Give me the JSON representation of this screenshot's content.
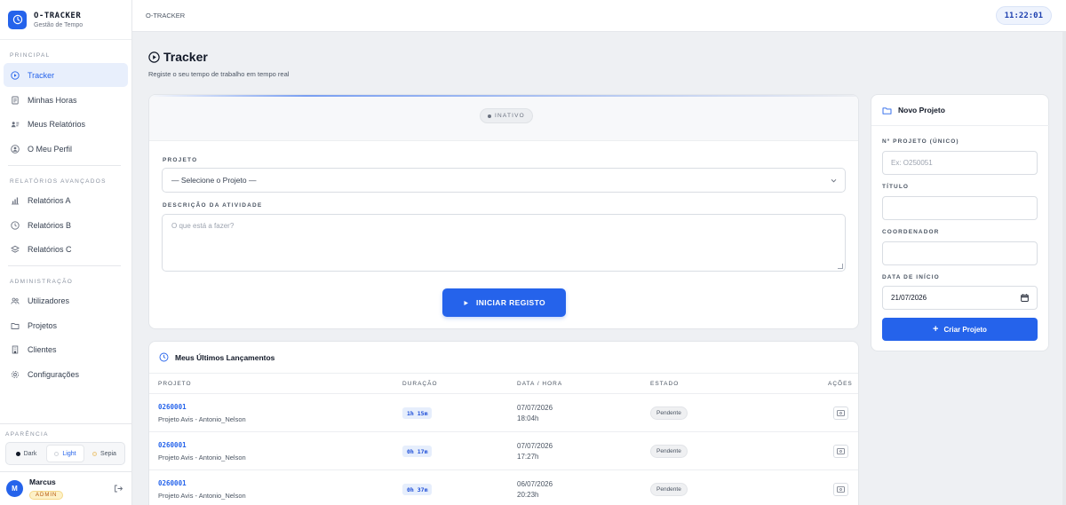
{
  "app": {
    "title": "O-TRACKER",
    "subtitle": "Gestão de Tempo",
    "breadcrumb": "O-TRACKER",
    "clock": "11:22:01"
  },
  "sidebar": {
    "sections": {
      "principal": "PRINCIPAL",
      "avancados": "RELATÓRIOS AVANÇADOS",
      "admin": "ADMINISTRAÇÃO",
      "aparencia": "APARÊNCIA"
    },
    "items": [
      {
        "label": "Tracker",
        "icon": "play-circle-icon"
      },
      {
        "label": "Minhas Horas",
        "icon": "document-icon"
      },
      {
        "label": "Meus Relatórios",
        "icon": "user-card-icon"
      },
      {
        "label": "O Meu Perfil",
        "icon": "user-circle-icon"
      },
      {
        "label": "Relatórios A",
        "icon": "bar-chart-icon"
      },
      {
        "label": "Relatórios B",
        "icon": "clock-icon"
      },
      {
        "label": "Relatórios C",
        "icon": "layers-icon"
      },
      {
        "label": "Utilizadores",
        "icon": "users-icon"
      },
      {
        "label": "Projetos",
        "icon": "folder-icon"
      },
      {
        "label": "Clientes",
        "icon": "building-icon"
      },
      {
        "label": "Configurações",
        "icon": "gear-icon"
      }
    ],
    "theme": {
      "dark": "Dark",
      "light": "Light",
      "sepia": "Sepia",
      "selected": "Light"
    },
    "user": {
      "initial": "M",
      "name": "Marcus",
      "role": "ADMIN"
    }
  },
  "page": {
    "title": "Tracker",
    "subtitle": "Registe o seu tempo de trabalho em tempo real"
  },
  "tracker": {
    "status": "INATIVO",
    "project_label": "PROJETO",
    "project_value": "— Selecione o Projeto —",
    "description_label": "DESCRIÇÃO DA ATIVIDADE",
    "description_placeholder": "O que está a fazer?",
    "start_button": "INICIAR REGISTO"
  },
  "recent": {
    "title": "Meus Últimos Lançamentos",
    "headers": [
      "PROJETO",
      "DURAÇÃO",
      "DATA / HORA",
      "ESTADO",
      "AÇÕES"
    ],
    "rows": [
      {
        "code": "0260001",
        "name": "Projeto Avis - Antonio_Nelson",
        "duration": "1h 15m",
        "date": "07/07/2026",
        "time": "18:04h",
        "state": "Pendente"
      },
      {
        "code": "0260001",
        "name": "Projeto Avis - Antonio_Nelson",
        "duration": "0h 17m",
        "date": "07/07/2026",
        "time": "17:27h",
        "state": "Pendente"
      },
      {
        "code": "0260001",
        "name": "Projeto Avis - Antonio_Nelson",
        "duration": "0h 37m",
        "date": "06/07/2026",
        "time": "20:23h",
        "state": "Pendente"
      }
    ]
  },
  "new_project": {
    "title": "Novo Projeto",
    "number_label": "Nº PROJETO (ÚNICO)",
    "number_placeholder": "Ex: O250051",
    "title_label": "TÍTULO",
    "coordinator_label": "COORDENADOR",
    "start_date_label": "DATA DE INÍCIO",
    "start_date_value": "21/07/2026",
    "create_button": "Criar Projeto"
  },
  "colors": {
    "accent": "#2563eb",
    "background": "#eef0f3",
    "role_badge": "#fdf1c7"
  }
}
